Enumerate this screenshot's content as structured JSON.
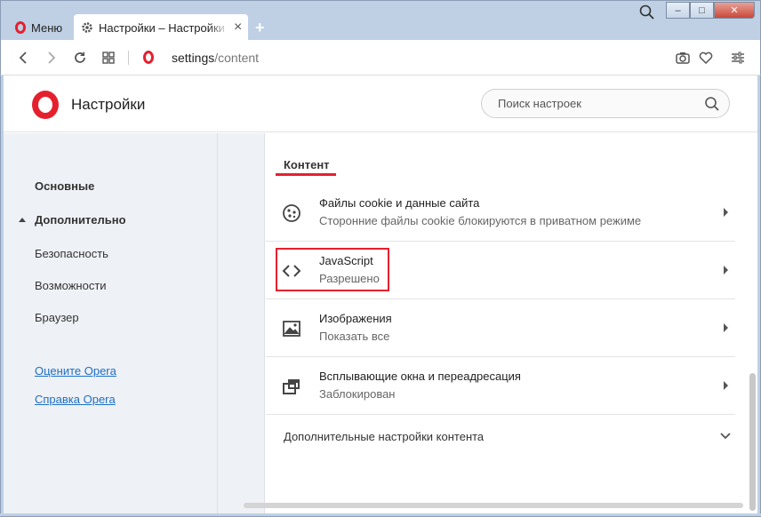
{
  "tabbar": {
    "menu_label": "Меню",
    "tab_title": "Настройки – Настройки сайта",
    "tab_close": "×",
    "new_tab": "+",
    "win_minimize": "–",
    "win_maximize": "□",
    "win_close": "✕"
  },
  "address": {
    "host": "settings",
    "path": "/content"
  },
  "header": {
    "title": "Настройки",
    "search_placeholder": "Поиск настроек"
  },
  "sidebar": {
    "items": [
      {
        "label": "Основные"
      },
      {
        "label": "Дополнительно"
      },
      {
        "label": "Безопасность"
      },
      {
        "label": "Возможности"
      },
      {
        "label": "Браузер"
      }
    ],
    "links": [
      {
        "label": "Оцените Opera"
      },
      {
        "label": "Справка Opera"
      }
    ]
  },
  "content": {
    "section_title": "Контент",
    "rows": [
      {
        "title": "Файлы cookie и данные сайта",
        "subtitle": "Сторонние файлы cookie блокируются в приватном режиме",
        "icon": "cookie-icon"
      },
      {
        "title": "JavaScript",
        "subtitle": "Разрешено",
        "icon": "code-icon"
      },
      {
        "title": "Изображения",
        "subtitle": "Показать все",
        "icon": "image-icon"
      },
      {
        "title": "Всплывающие окна и переадресация",
        "subtitle": "Заблокирован",
        "icon": "popup-icon"
      }
    ],
    "advanced_label": "Дополнительные настройки контента"
  },
  "colors": {
    "brand": "#e5202e",
    "link": "#1f6fc5",
    "sidebar_bg": "#eef1f5"
  }
}
